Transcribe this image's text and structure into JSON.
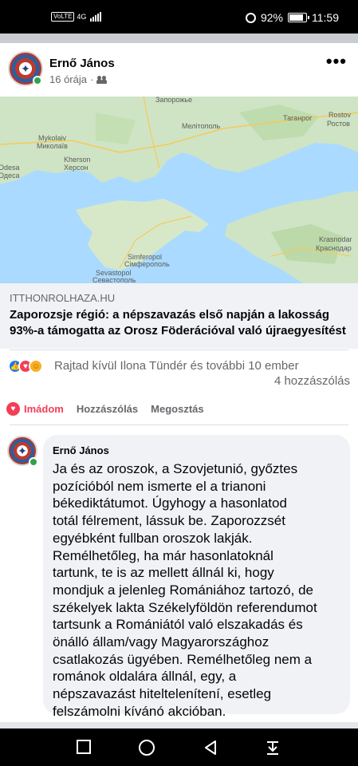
{
  "status_bar": {
    "network": "VoLTE",
    "signal": "4G",
    "battery": "92%",
    "battery_level": 0.92,
    "time": "11:59"
  },
  "post": {
    "author": "Ernő János",
    "time": "16 órája",
    "privacy_icon": "friends-icon",
    "more_icon": "more-icon"
  },
  "map": {
    "labels": {
      "zaporozhe": "Запорожье",
      "rostov": "Rostov",
      "rostov_cy": "Ростов",
      "mykolaiv": "Mykolaiv",
      "mykolaiv_cy": "Миколаїв",
      "kherson": "Kherson",
      "kherson_cy": "Херсон",
      "odesa": "Odesa",
      "odesa_cy": "Одеса",
      "krasnodar": "Krasnodar",
      "krasnodar_cy": "Краснодар",
      "sevastopol": "Sevastopol",
      "sevastopol_cy": "Севастополь",
      "simferopol": "Simferopol",
      "simferopol_cy": "Сімферополь",
      "melitopol": "Мелітополь",
      "taganrog": "Таганрог"
    }
  },
  "link": {
    "domain": "ITTHONROLHAZA.HU",
    "title": "Zaporozsje régió: a népszavazás első napján a lakosság 93%-a támogatta az Orosz Föderációval való újraegyesítést"
  },
  "reactions": {
    "text": "Rajtad kívül Ilona Tündér és további 10 ember",
    "comments": "4 hozzászólás",
    "types": [
      "like",
      "love",
      "care"
    ]
  },
  "actions": {
    "love": "Imádom",
    "comment": "Hozzászólás",
    "share": "Megosztás"
  },
  "comment": {
    "author": "Ernő János",
    "lines": [
      "Ja és az oroszok, a Szovjetunió, győztes",
      "pozícióból nem ismerte el a trianoni",
      "békediktátumot. Úgyhogy a hasonlatod",
      "totál félrement, lássuk be. Zaporozzsét",
      "egyébként fullban oroszok lakják.",
      "Remélhetőleg, ha már hasonlatoknál",
      "tartunk, te is az mellett állnál ki, hogy",
      "mondjuk a jelenleg Romániához tartozó, de",
      "székelyek lakta Székelyföldön referendumot",
      "tartsunk a Romániától való elszakadás és",
      "önálló állam/vagy Magyarországhoz",
      "csatlakozás ügyében. Remélhetőleg nem a",
      "románok oldalára állnál, egy, a",
      "népszavazást hiteltelenítení, esetleg",
      "felszámolni kívánó akcióban."
    ]
  },
  "colors": {
    "facebook_blue": "#1877f2",
    "love_red": "#f33e58",
    "online_green": "#31a24c"
  }
}
